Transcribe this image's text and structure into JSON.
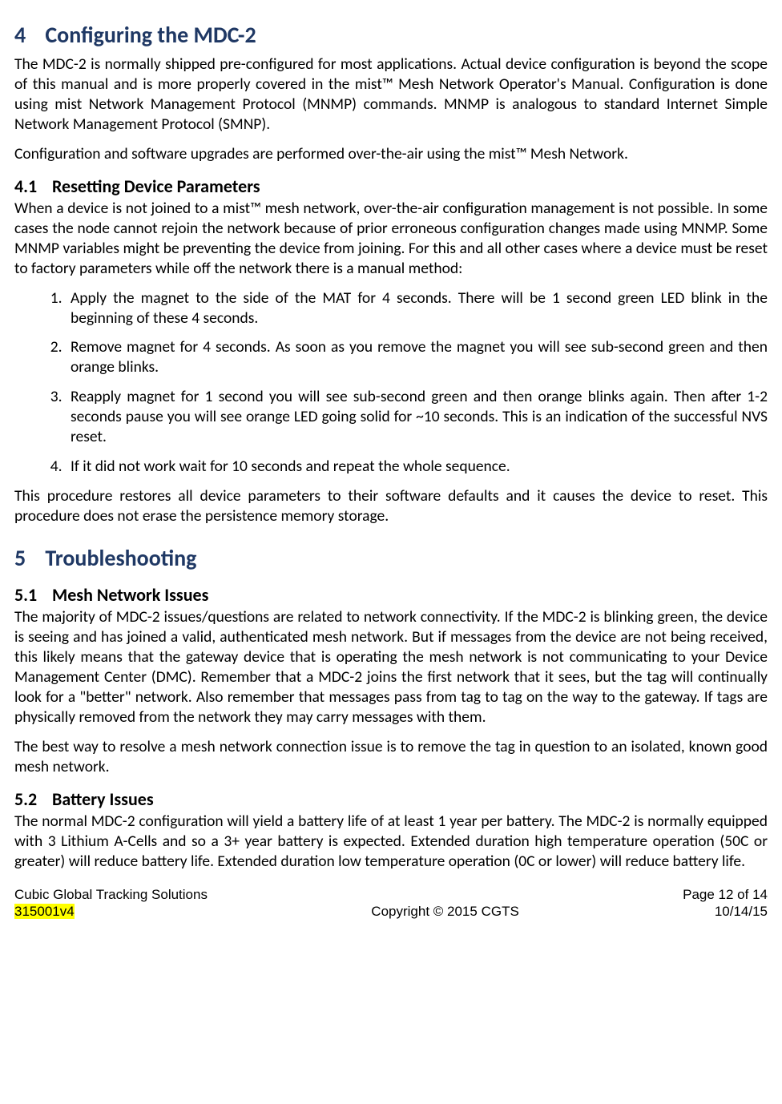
{
  "sec4": {
    "num": "4",
    "title": "Configuring the MDC-2",
    "p1": "The MDC-2 is normally shipped pre-configured for most applications. Actual device configuration is beyond the scope of this manual and is more properly covered in the mist™ Mesh Network Operator's Manual. Configuration is done using mist Network Management Protocol (MNMP) commands. MNMP is analogous to standard Internet Simple Network Management Protocol (SMNP).",
    "p2": "Configuration and software upgrades are performed over-the-air using the mist™ Mesh Network."
  },
  "sec41": {
    "num": "4.1",
    "title": "Resetting Device Parameters",
    "p1": "When a device is not joined to a mist™ mesh network, over-the-air configuration management is not possible. In some cases the node cannot rejoin the network because of prior erroneous configuration changes made using MNMP. Some MNMP variables might be preventing the device from joining. For this and all other cases where a device must be reset to factory parameters while off the network there is a manual method:",
    "li1": "Apply the magnet to the side of the MAT for 4 seconds. There will be 1 second green LED blink in the beginning of these 4 seconds.",
    "li2": "Remove magnet for 4 seconds. As soon as you remove the magnet you will see sub-second green and then orange blinks.",
    "li3": "Reapply magnet for 1 second you will see sub-second green and then orange blinks again. Then after 1-2 seconds pause you will see orange LED going solid for ~10 seconds. This is an indication of the successful NVS reset.",
    "li4": "If it did not work wait for 10 seconds and repeat the whole sequence.",
    "p2": "This procedure restores all device parameters to their software defaults and it causes the device to reset. This procedure does not erase the persistence memory storage."
  },
  "sec5": {
    "num": "5",
    "title": "Troubleshooting"
  },
  "sec51": {
    "num": "5.1",
    "title": "Mesh Network Issues",
    "p1": "The majority of MDC-2 issues/questions are related to network connectivity. If the MDC-2 is blinking green, the device is seeing and has joined a valid, authenticated mesh network. But if messages from the device are not being received, this likely means that the gateway device that is operating the mesh network is not communicating to your Device Management Center (DMC). Remember that a MDC-2 joins the first network that it sees, but the tag will continually look for a \"better\" network. Also remember that messages pass from tag to tag on the way to the gateway. If tags are physically removed from the network they may carry messages with them.",
    "p2": "The best way to resolve a mesh network connection issue is to remove the tag in question to an isolated, known good mesh network."
  },
  "sec52": {
    "num": "5.2",
    "title": "Battery Issues",
    "p1": "The normal MDC-2 configuration will yield a battery life of at least 1 year per battery. The MDC-2 is normally equipped with 3 Lithium A-Cells and so a 3+ year battery is expected. Extended duration high temperature operation (50C or greater) will reduce battery life. Extended duration low temperature operation (0C or lower) will reduce battery life."
  },
  "footer": {
    "company": "Cubic Global Tracking Solutions",
    "docid": "315001v4",
    "copyright": "Copyright © 2015 CGTS",
    "pageinfo": "Page 12 of 14",
    "date": "10/14/15"
  }
}
